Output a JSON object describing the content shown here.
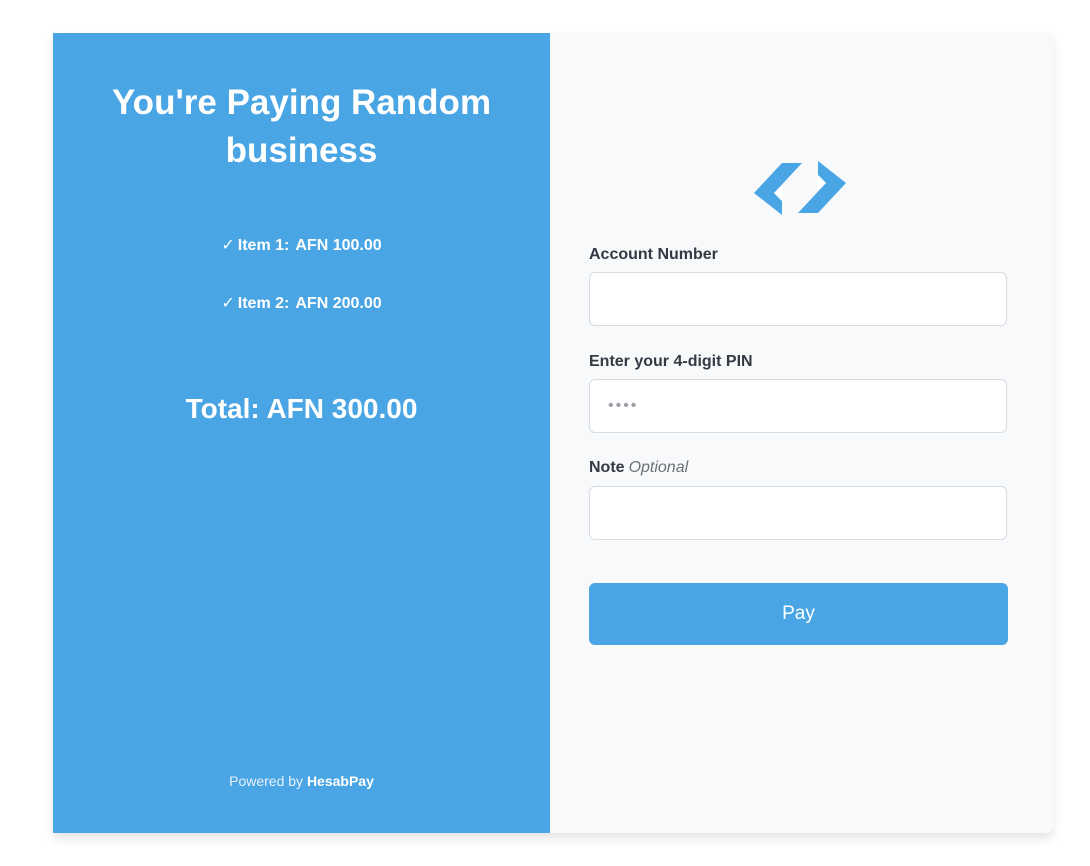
{
  "summary": {
    "title": "You're Paying Random business",
    "items": [
      {
        "check": "✓",
        "label": "Item 1:",
        "amount": "AFN 100.00"
      },
      {
        "check": "✓",
        "label": "Item 2:",
        "amount": "AFN 200.00"
      }
    ],
    "total": "Total: AFN 300.00",
    "powered_prefix": "Powered by",
    "powered_brand": "HesabPay"
  },
  "form": {
    "logo_icon": "hesabpay-logo-icon",
    "account_label": "Account Number",
    "account_value": "",
    "pin_label": "Enter your 4-digit PIN",
    "pin_placeholder": "••••",
    "note_label": "Note",
    "note_optional": "Optional",
    "note_value": "",
    "pay_label": "Pay"
  },
  "colors": {
    "brand_blue": "#49a5e3",
    "panel_bg": "#f8f9fb",
    "label_text": "#333a44"
  }
}
